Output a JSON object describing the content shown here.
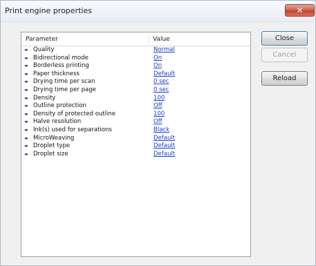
{
  "window": {
    "title": "Print engine properties",
    "close_glyph": "✕"
  },
  "list": {
    "headers": {
      "parameter": "Parameter",
      "value": "Value"
    },
    "rows": [
      {
        "name": "Quality",
        "value": "Normal"
      },
      {
        "name": "Bidirectional mode",
        "value": "On"
      },
      {
        "name": "Borderless printing",
        "value": "On"
      },
      {
        "name": "Paper thickness",
        "value": "Default"
      },
      {
        "name": "Drying time per scan",
        "value": "0 sec"
      },
      {
        "name": "Drying time per page",
        "value": "0 sec"
      },
      {
        "name": "Density",
        "value": "100"
      },
      {
        "name": "Outline protection",
        "value": "Off"
      },
      {
        "name": "Density of protected outline",
        "value": "100"
      },
      {
        "name": "Halve resolution",
        "value": "Off"
      },
      {
        "name": "Ink(s) used for separations",
        "value": "Black"
      },
      {
        "name": "MicroWeaving",
        "value": "Default"
      },
      {
        "name": "Droplet type",
        "value": "Default"
      },
      {
        "name": "Droplet size",
        "value": "Default"
      }
    ],
    "row_icon": "left-right-arrows-icon",
    "row_glyph": "◂▸"
  },
  "buttons": {
    "close": "Close",
    "cancel": "Cancel",
    "reload": "Reload"
  },
  "colors": {
    "link": "#1a3cc8",
    "arrow": "#1d3f8a",
    "close_x": "#c3432c"
  }
}
